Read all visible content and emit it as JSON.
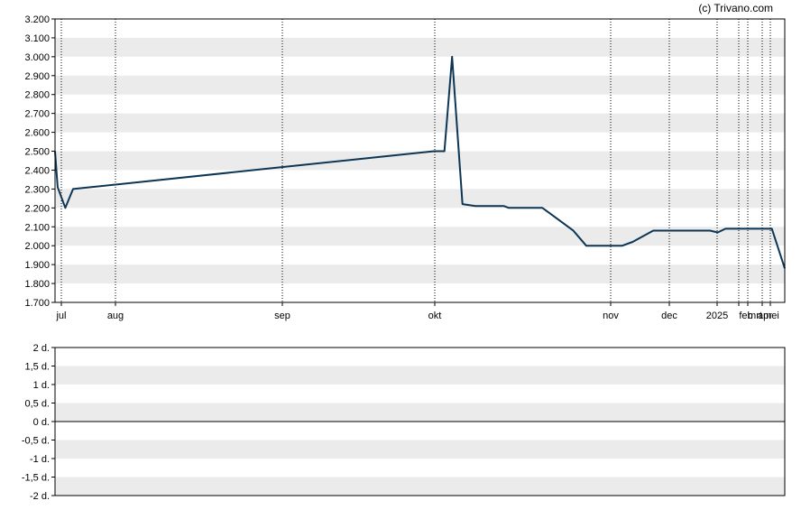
{
  "credit": "(c) Trivano.com",
  "colors": {
    "line": "#0d3554",
    "band": "#ebebeb",
    "border": "#000000",
    "grid": "#000000"
  },
  "chart_data": [
    {
      "type": "line",
      "title": "",
      "xlabel": "",
      "ylabel": "",
      "x_tick_labels": [
        "jul",
        "aug",
        "sep",
        "okt",
        "nov",
        "dec",
        "2025",
        "feb",
        "mrt",
        "apr",
        "mei"
      ],
      "y_tick_labels": [
        "1.700",
        "1.800",
        "1.900",
        "2.000",
        "2.100",
        "2.200",
        "2.300",
        "2.400",
        "2.500",
        "2.600",
        "2.700",
        "2.800",
        "2.900",
        "3.000",
        "3.100",
        "3.200"
      ],
      "ylim": [
        1700,
        3200
      ],
      "grid": "alternating horizontal bands, dotted vertical month lines",
      "series": [
        {
          "x": [
            "2024-06-26",
            "2024-06-27",
            "2024-06-30",
            "2024-07-03",
            "2024-11-20",
            "2024-11-24",
            "2024-11-27",
            "2024-12-01",
            "2024-12-06",
            "2024-12-08",
            "2024-12-17",
            "2024-12-19",
            "2024-12-21",
            "2025-01-01",
            "2025-01-04",
            "2025-01-13",
            "2025-01-18",
            "2025-02-01",
            "2025-02-05",
            "2025-02-13",
            "2025-02-25",
            "2025-03-07",
            "2025-03-10",
            "2025-03-13",
            "2025-03-31",
            "2025-04-05"
          ],
          "values": [
            2500,
            2310,
            2200,
            2300,
            2500,
            2500,
            3000,
            2220,
            2210,
            2210,
            2210,
            2200,
            2200,
            2200,
            2170,
            2080,
            2000,
            2000,
            2020,
            2080,
            2080,
            2080,
            2070,
            2090,
            2090,
            1880
          ]
        }
      ]
    },
    {
      "type": "line",
      "title": "",
      "xlabel": "",
      "ylabel": "",
      "y_tick_labels": [
        "-2 d.",
        "-1,5 d.",
        "-1 d.",
        "-0,5 d.",
        "0 d.",
        "0,5 d.",
        "1 d.",
        "1,5 d.",
        "2 d."
      ],
      "ylim": [
        -2,
        2
      ],
      "grid": "alternating horizontal bands",
      "series": [],
      "reference_line": 0
    }
  ]
}
